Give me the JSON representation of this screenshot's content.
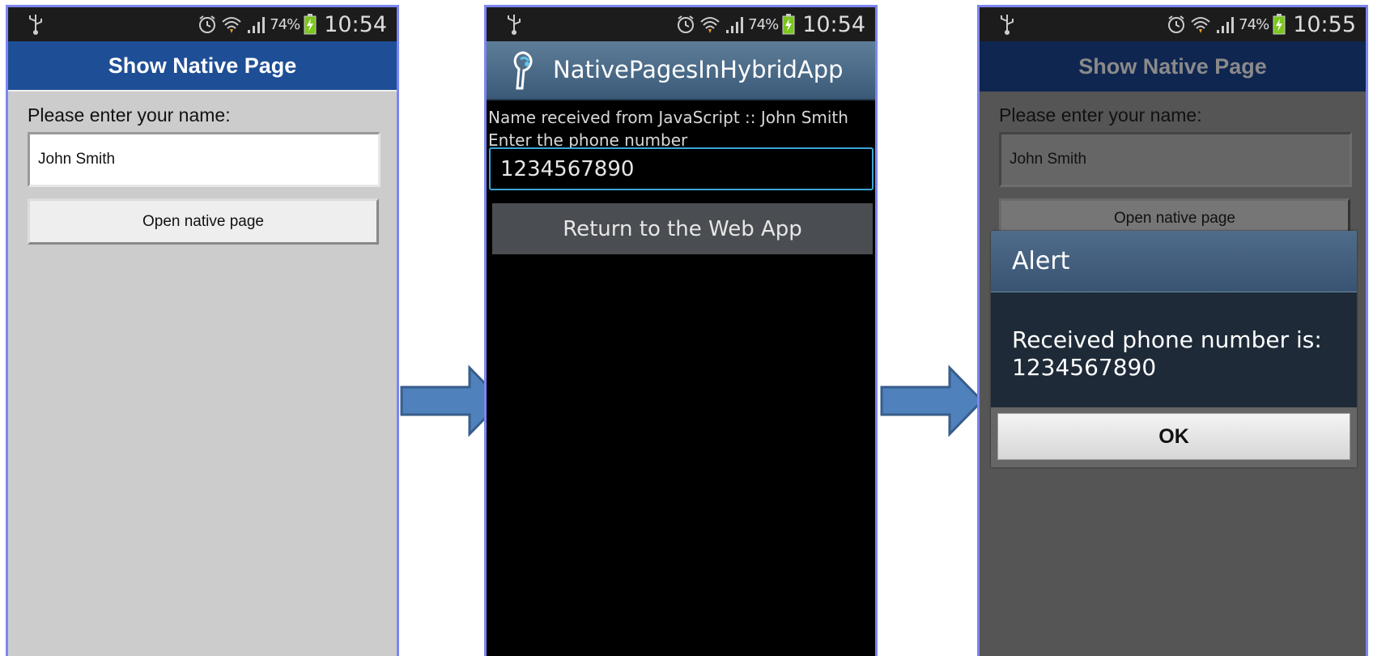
{
  "status_bars": [
    {
      "battery": "74%",
      "time": "10:54"
    },
    {
      "battery": "74%",
      "time": "10:54"
    },
    {
      "battery": "74%",
      "time": "10:55"
    }
  ],
  "screen1": {
    "header_title": "Show Native Page",
    "name_label": "Please enter your name:",
    "name_value": "John Smith",
    "open_button": "Open native page"
  },
  "screen2": {
    "app_title": "NativePagesInHybridApp",
    "received_text": "Name received from JavaScript :: John Smith",
    "phone_label": "Enter the phone number",
    "phone_value": "1234567890",
    "return_button": "Return to the Web App"
  },
  "screen3": {
    "header_title": "Show Native Page",
    "name_label": "Please enter your name:",
    "name_value": "John Smith",
    "open_button": "Open native page",
    "alert": {
      "title": "Alert",
      "message_line1": "Received phone number is:",
      "message_line2": "1234567890",
      "ok_button": "OK"
    }
  },
  "colors": {
    "phone_border": "#7d86f0",
    "web_header": "#1e4e96",
    "arrow_fill": "#4f81bd",
    "arrow_stroke": "#385d8a",
    "native_input_focus": "#3ba5d8"
  },
  "icons": [
    "usb-icon",
    "alarm-icon",
    "wifi-icon",
    "signal-icon",
    "battery-charging-icon",
    "app-logo-icon",
    "right-arrow-icon"
  ]
}
